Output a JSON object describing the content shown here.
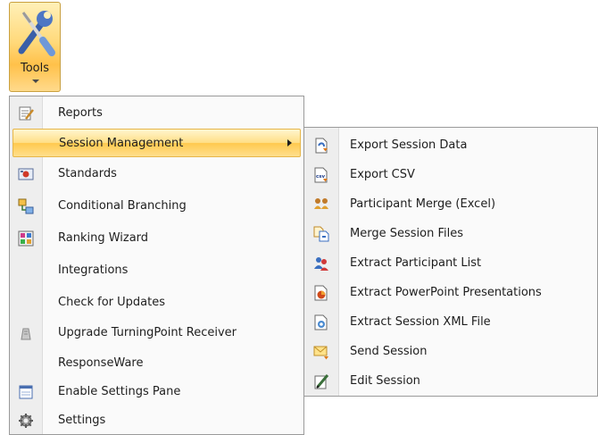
{
  "ribbon": {
    "tools_label": "Tools",
    "accent_color": "#ffc94e"
  },
  "menu": {
    "items": [
      {
        "label": "Reports",
        "icon": "reports-icon"
      },
      {
        "label": "Session Management",
        "icon": "",
        "has_submenu": true,
        "active": true
      },
      {
        "label": "Standards",
        "icon": "standards-icon"
      },
      {
        "label": "Conditional Branching",
        "icon": "branching-icon"
      },
      {
        "label": "Ranking Wizard",
        "icon": "ranking-icon"
      },
      {
        "label": "Integrations",
        "icon": ""
      },
      {
        "label": "Check for Updates",
        "icon": ""
      },
      {
        "label": "Upgrade TurningPoint Receiver",
        "icon": "receiver-icon"
      },
      {
        "label": "ResponseWare",
        "icon": ""
      },
      {
        "label": "Enable Settings Pane",
        "icon": "settings-pane-icon"
      },
      {
        "label": "Settings",
        "icon": "gear-icon"
      }
    ]
  },
  "submenu": {
    "items": [
      {
        "label": "Export Session Data",
        "icon": "export-session-icon"
      },
      {
        "label": "Export CSV",
        "icon": "csv-icon"
      },
      {
        "label": "Participant Merge (Excel)",
        "icon": "participants-icon"
      },
      {
        "label": "Merge Session Files",
        "icon": "merge-icon"
      },
      {
        "label": "Extract Participant List",
        "icon": "participant-list-icon"
      },
      {
        "label": "Extract PowerPoint Presentations",
        "icon": "powerpoint-icon"
      },
      {
        "label": "Extract Session XML File",
        "icon": "xml-icon"
      },
      {
        "label": "Send Session",
        "icon": "envelope-icon"
      },
      {
        "label": "Edit Session",
        "icon": "edit-icon"
      }
    ],
    "csv_icon_text": "csv"
  }
}
